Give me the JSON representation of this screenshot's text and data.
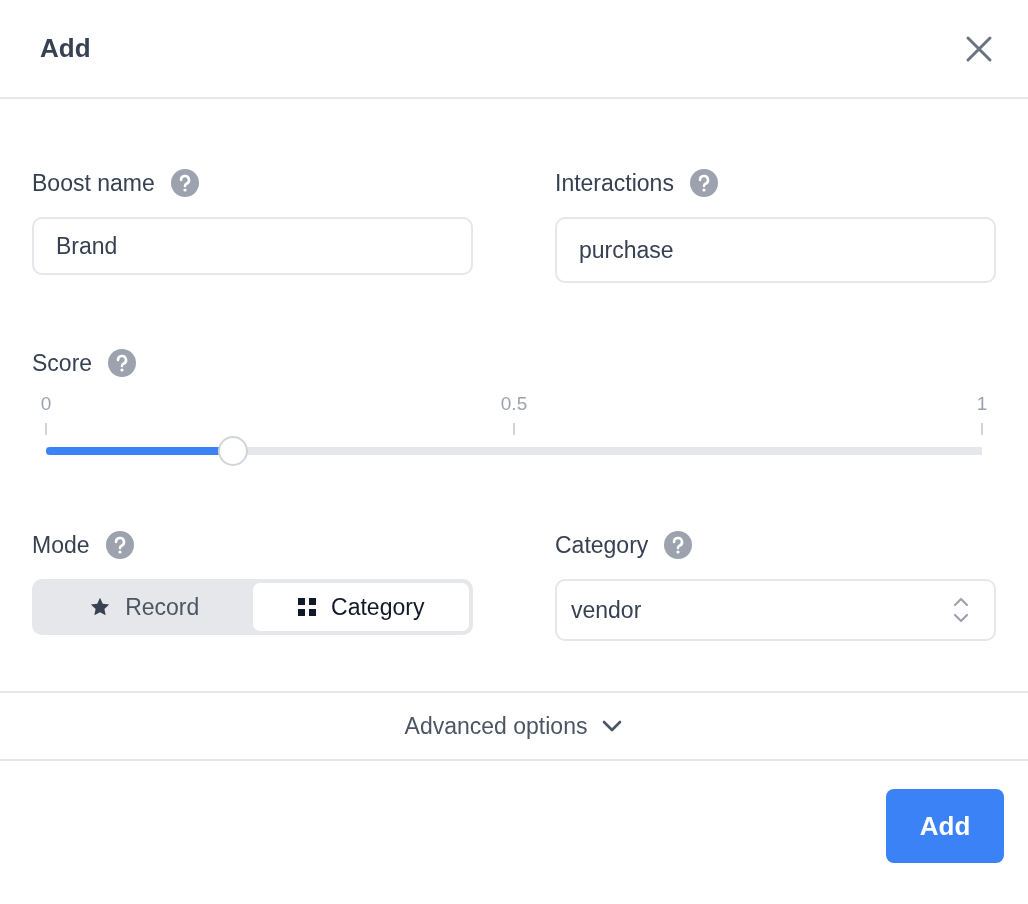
{
  "window": {
    "title": "Add"
  },
  "fields": [
    {
      "label": "Boost name",
      "value": "Brand"
    },
    {
      "label": "Interactions",
      "value": "purchase"
    }
  ],
  "score": {
    "label": "Score",
    "ticks": [
      "0",
      "0.5",
      "1"
    ],
    "level": 0.2
  },
  "mode": {
    "label": "Mode",
    "options": [
      {
        "label": "Record",
        "selected": false
      },
      {
        "label": "Category",
        "selected": true
      }
    ]
  },
  "category": {
    "label": "Category",
    "value": "vendor"
  },
  "advanced": {
    "label": "Advanced options",
    "expanded": false
  },
  "buttons": [
    {
      "label": "Add"
    }
  ]
}
